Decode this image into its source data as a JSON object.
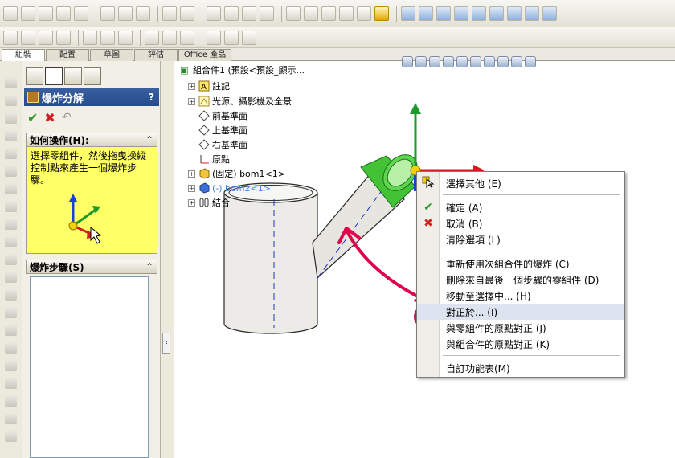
{
  "tabs": [
    "組裝",
    "配置",
    "草圖",
    "評估",
    "Office 產品"
  ],
  "property_manager": {
    "title": "爆炸分解",
    "help_label": "?",
    "howto_header": "如何操作(H):",
    "howto_text": "選擇零組件，然後拖曳操縱控制點來產生一個爆炸步驟。",
    "steps_header": "爆炸步驟(S)",
    "collapse_glyph": "⌃"
  },
  "feature_tree": [
    {
      "label": "組合件1  (預設<預設_顯示...",
      "icon": "assembly-icon",
      "expander": ""
    },
    {
      "label": "註記",
      "icon": "annotation-icon",
      "expander": "+"
    },
    {
      "label": "光源、攝影機及全景",
      "icon": "lights-icon",
      "expander": "+"
    },
    {
      "label": "前基準面",
      "icon": "plane-icon",
      "expander": ""
    },
    {
      "label": "上基準面",
      "icon": "plane-icon",
      "expander": ""
    },
    {
      "label": "右基準面",
      "icon": "plane-icon",
      "expander": ""
    },
    {
      "label": "原點",
      "icon": "origin-icon",
      "expander": ""
    },
    {
      "label": "(固定) bom1<1>",
      "icon": "part-icon",
      "expander": "+"
    },
    {
      "label": "(-) bom2<1>",
      "icon": "part-icon",
      "expander": "+"
    },
    {
      "label": "結合",
      "icon": "mates-icon",
      "expander": "+"
    }
  ],
  "context_menu": {
    "items": [
      {
        "label": "選擇其他 (E)",
        "glyph": "select-other-icon"
      },
      {
        "label": "確定 (A)",
        "glyph": "ok-icon"
      },
      {
        "label": "取消 (B)",
        "glyph": "cancel-icon"
      },
      {
        "label": "清除選項 (L)",
        "glyph": ""
      },
      {
        "label": "重新使用次組合件的爆炸 (C)",
        "glyph": ""
      },
      {
        "label": "刪除來自最後一個步驟的零組件 (D)",
        "glyph": ""
      },
      {
        "label": "移動至選擇中... (H)",
        "glyph": ""
      },
      {
        "label": "對正於... (I)",
        "glyph": ""
      },
      {
        "label": "與零組件的原點對正 (J)",
        "glyph": ""
      },
      {
        "label": "與組合件的原點對正 (K)",
        "glyph": ""
      },
      {
        "label": "自訂功能表(M)",
        "glyph": ""
      }
    ]
  },
  "colors": {
    "accent": "#264c8c",
    "howto_bg": "#ffff66",
    "annotation": "#e0004e",
    "triad_y": "#1a9a2a",
    "triad_x": "#d81c1c",
    "triad_z": "#1c3fd8",
    "highlight": "#42c234"
  }
}
